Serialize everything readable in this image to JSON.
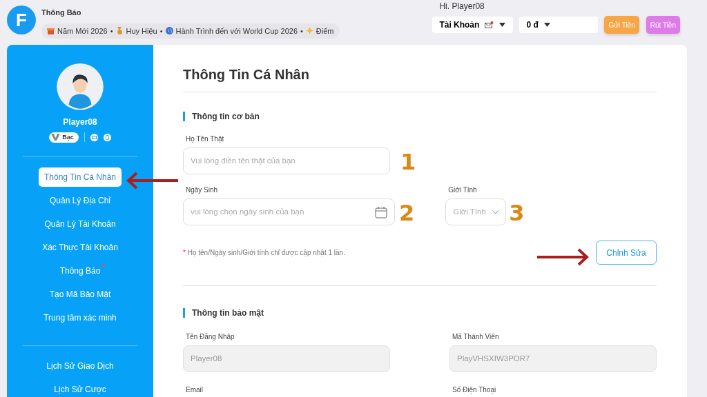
{
  "header": {
    "logo_letter": "F",
    "notice_title": "Thông Báo",
    "ticker": [
      {
        "kind": "gift",
        "label": "Năm Mới 2026"
      },
      {
        "kind": "medal",
        "label": "Huy Hiệu"
      },
      {
        "kind": "globe",
        "label": "Hành Trình đến với World Cup 2026"
      },
      {
        "kind": "sparkle",
        "label": "Điểm"
      }
    ],
    "separator": "•",
    "greeting": "Hi. Player08",
    "account_menu": {
      "label": "Tài Khoản",
      "unread": true
    },
    "balance": {
      "label": "0 đ"
    },
    "buttons": [
      {
        "kind": "deposit",
        "label": "Gửi Tiền"
      },
      {
        "kind": "withdraw",
        "label": "Rút Tiền"
      }
    ]
  },
  "sidebar": {
    "username": "Player08",
    "rank": "Bạc",
    "menu_groups": [
      [
        {
          "label": "Thông Tin Cá Nhân",
          "selected": true,
          "dot": false
        },
        {
          "label": "Quản Lý Địa Chỉ",
          "selected": false,
          "dot": false
        },
        {
          "label": "Quản Lý Tài Khoản",
          "selected": false,
          "dot": false
        },
        {
          "label": "Xác Thực Tài Khoản",
          "selected": false,
          "dot": false
        },
        {
          "label": "Thông Báo",
          "selected": false,
          "dot": true
        },
        {
          "label": "Tạo Mã Bảo Mật",
          "selected": false,
          "dot": false
        },
        {
          "label": "Trung tâm xác minh",
          "selected": false,
          "dot": false
        }
      ],
      [
        {
          "label": "Lịch Sử Giao Dịch",
          "selected": false,
          "dot": false
        },
        {
          "label": "Lịch Sử Cược",
          "selected": false,
          "dot": false
        }
      ]
    ]
  },
  "main": {
    "title": "Thông Tin Cá Nhân",
    "basic": {
      "heading": "Thông tin cơ bản",
      "name": {
        "label": "Họ Tên Thật",
        "placeholder": "Vui lòng điền tên thật của bạn",
        "marker": "1"
      },
      "birthday": {
        "label": "Ngày Sinh",
        "placeholder": "vui lòng chọn ngày sinh của bạn",
        "marker": "2"
      },
      "gender": {
        "label": "Giới Tính",
        "placeholder": "Giới Tính",
        "marker": "3"
      },
      "note_star": "*",
      "note": "Họ tên/Ngày sinh/Giới tính chỉ được cập nhật 1 lần.",
      "edit_button": "Chỉnh Sửa"
    },
    "security": {
      "heading": "Thông tin bảo mật",
      "fields": [
        {
          "label": "Tên Đăng Nhập",
          "value": "Player08"
        },
        {
          "label": "Mã Thành Viên",
          "value": "PlayVHSXIW3POR7"
        },
        {
          "label": "Email"
        },
        {
          "label": "Số Điện Thoại"
        }
      ]
    }
  }
}
